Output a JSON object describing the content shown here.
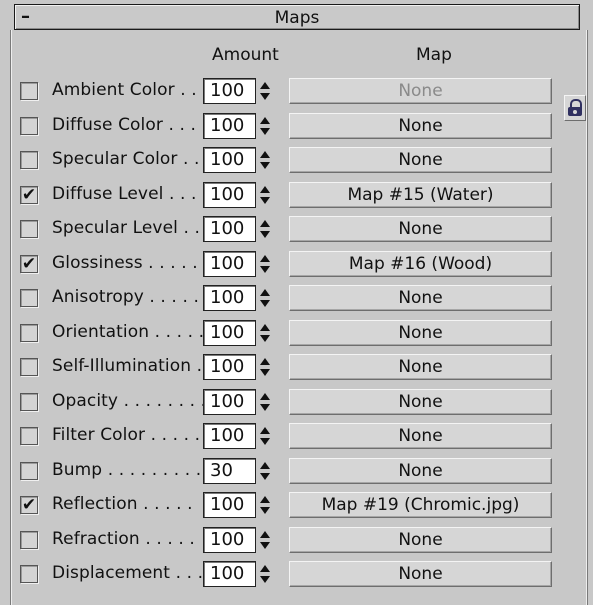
{
  "rollout": {
    "collapse_symbol": "–",
    "title": "Maps"
  },
  "columns": {
    "amount": "Amount",
    "map": "Map"
  },
  "rows": [
    {
      "label": "Ambient Color . . .",
      "checked": false,
      "amount": "100",
      "map": "None",
      "map_disabled": true
    },
    {
      "label": "Diffuse Color . . . .",
      "checked": false,
      "amount": "100",
      "map": "None",
      "map_disabled": false
    },
    {
      "label": "Specular Color  . .",
      "checked": false,
      "amount": "100",
      "map": "None",
      "map_disabled": false
    },
    {
      "label": "Diffuse Level . . .",
      "checked": true,
      "amount": "100",
      "map": "Map #15  (Water)",
      "map_disabled": false
    },
    {
      "label": "Specular Level  . .",
      "checked": false,
      "amount": "100",
      "map": "None",
      "map_disabled": false
    },
    {
      "label": "Glossiness  . . . . .",
      "checked": true,
      "amount": "100",
      "map": "Map #16  (Wood)",
      "map_disabled": false
    },
    {
      "label": "Anisotropy  . . . . .",
      "checked": false,
      "amount": "100",
      "map": "None",
      "map_disabled": false
    },
    {
      "label": "Orientation . . . . .",
      "checked": false,
      "amount": "100",
      "map": "None",
      "map_disabled": false
    },
    {
      "label": "Self-Illumination  .",
      "checked": false,
      "amount": "100",
      "map": "None",
      "map_disabled": false
    },
    {
      "label": "Opacity . . . . . . . .",
      "checked": false,
      "amount": "100",
      "map": "None",
      "map_disabled": false
    },
    {
      "label": "Filter Color  . . . . .",
      "checked": false,
      "amount": "100",
      "map": "None",
      "map_disabled": false
    },
    {
      "label": "Bump  . . . . . . . . .",
      "checked": false,
      "amount": "30",
      "map": "None",
      "map_disabled": false
    },
    {
      "label": "Reflection  . . . . .",
      "checked": true,
      "amount": "100",
      "map": "Map #19 (Chromic.jpg)",
      "map_disabled": false
    },
    {
      "label": "Refraction  . . . . .",
      "checked": false,
      "amount": "100",
      "map": "None",
      "map_disabled": false
    },
    {
      "label": "Displacement  . . .",
      "checked": false,
      "amount": "100",
      "map": "None",
      "map_disabled": false
    }
  ],
  "icons": {
    "lock": "lock-icon",
    "checkmark": "✔"
  }
}
